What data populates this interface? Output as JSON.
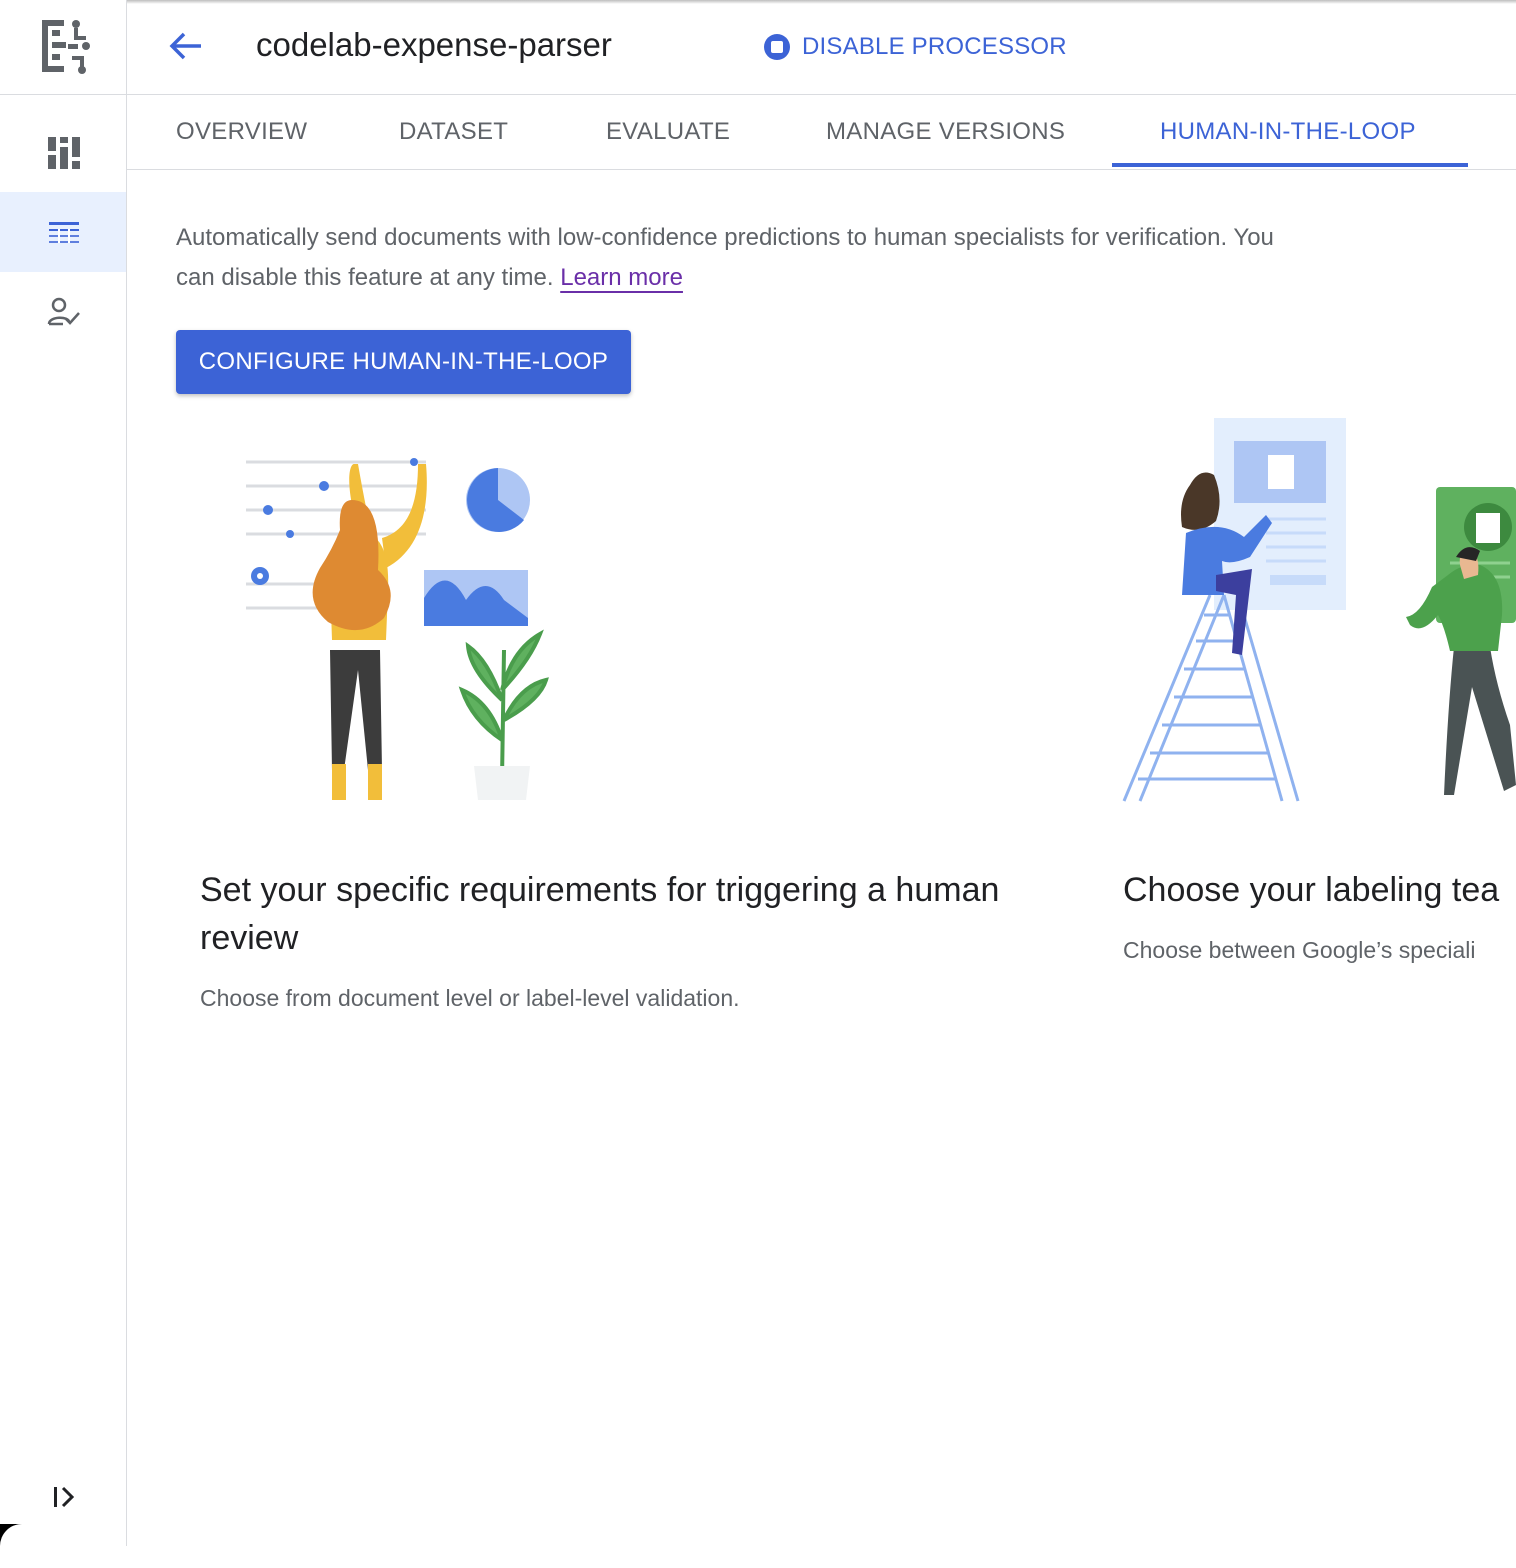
{
  "header": {
    "title": "codelab-expense-parser",
    "disable_label": "DISABLE PROCESSOR"
  },
  "tabs": [
    {
      "label": "OVERVIEW",
      "active": false
    },
    {
      "label": "DATASET",
      "active": false
    },
    {
      "label": "EVALUATE",
      "active": false
    },
    {
      "label": "MANAGE VERSIONS",
      "active": false
    },
    {
      "label": "HUMAN-IN-THE-LOOP",
      "active": true
    }
  ],
  "main": {
    "description": "Automatically send documents with low-confidence predictions to human specialists for verification. You can disable this feature at any time.",
    "learn_more": "Learn more",
    "cta_label": "CONFIGURE HUMAN-IN-THE-LOOP"
  },
  "cards": [
    {
      "title": "Set your specific requirements for triggering a human review",
      "subtitle": "Choose from document level or label-level validation."
    },
    {
      "title": "Choose your labeling tea",
      "subtitle": "Choose between Google’s speciali"
    }
  ],
  "colors": {
    "accent": "#3c63d6",
    "link": "#6a2fa8",
    "rail_active": "#e8f0fe"
  },
  "icons": {
    "logo": "document-ai-icon",
    "rail": [
      "dashboard-icon",
      "table-icon",
      "person-check-icon"
    ],
    "back": "arrow-back-icon",
    "disable": "stop-circle-icon",
    "expand": "expand-rail-icon"
  }
}
